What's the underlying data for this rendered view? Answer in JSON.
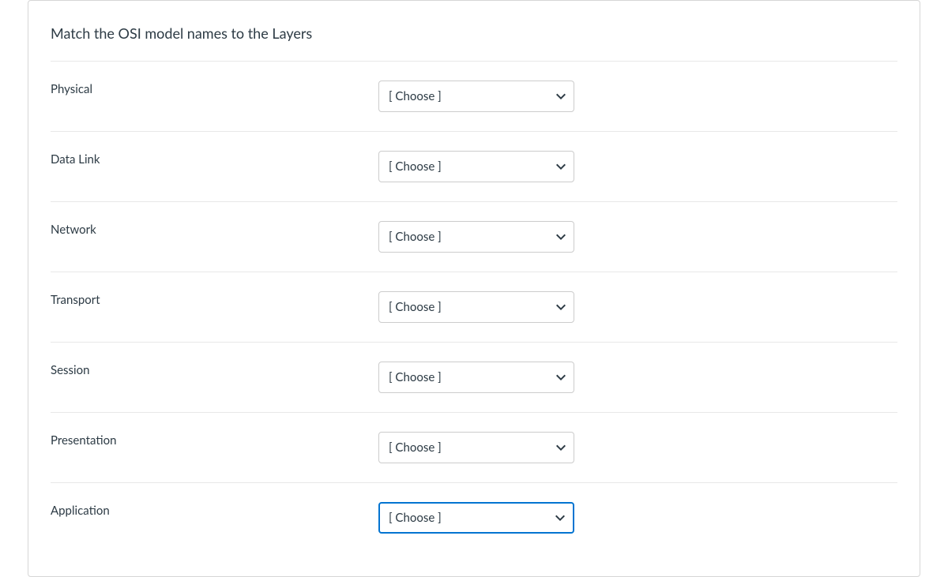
{
  "prompt": "Match the OSI model names to the Layers",
  "choose_placeholder": "[ Choose ]",
  "items": [
    {
      "label": "Physical",
      "focused": false
    },
    {
      "label": "Data Link",
      "focused": false
    },
    {
      "label": "Network",
      "focused": false
    },
    {
      "label": "Transport",
      "focused": false
    },
    {
      "label": "Session",
      "focused": false
    },
    {
      "label": "Presentation",
      "focused": false
    },
    {
      "label": "Application",
      "focused": true
    }
  ]
}
